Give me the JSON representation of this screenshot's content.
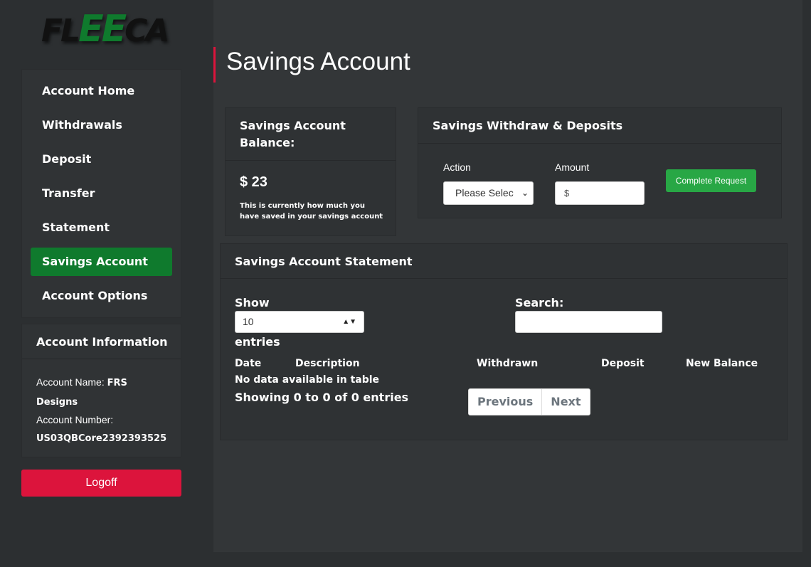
{
  "logo": {
    "part1": "FL",
    "part2": "EE",
    "part3": "CA"
  },
  "sidebar": {
    "items": [
      {
        "label": "Account Home"
      },
      {
        "label": "Withdrawals"
      },
      {
        "label": "Deposit"
      },
      {
        "label": "Transfer"
      },
      {
        "label": "Statement"
      },
      {
        "label": "Savings Account",
        "active": true
      },
      {
        "label": "Account Options"
      }
    ],
    "active_color": "#0f7a2d"
  },
  "account_info": {
    "heading": "Account Information",
    "name_label": "Account Name:",
    "name_value_1": "FRS",
    "name_value_2": "Designs",
    "number_label": "Account Number:",
    "number_value": "US03QBCore2392393525"
  },
  "logoff": {
    "label": "Logoff",
    "color": "#dc143c"
  },
  "main": {
    "title": "Savings Account",
    "balance": {
      "heading": "Savings Account Balance:",
      "amount": "$ 23",
      "note": "This is currently how much you have saved in your savings account"
    },
    "withdraw": {
      "heading": "Savings Withdraw & Deposits",
      "action_label": "Action",
      "action_value": "Please Selec",
      "amount_label": "Amount",
      "amount_placeholder": "$",
      "submit_label": "Complete Request",
      "submit_color": "#28a745"
    },
    "statement": {
      "heading": "Savings Account Statement",
      "show_label": "Show",
      "show_value": "10",
      "entries_label": "entries",
      "search_label": "Search:",
      "columns": [
        "Date",
        "Description",
        "Withdrawn",
        "Deposit",
        "New Balance"
      ],
      "empty_text": "No data available in table",
      "info_text": "Showing 0 to 0 of 0 entries",
      "prev_label": "Previous",
      "next_label": "Next"
    }
  }
}
